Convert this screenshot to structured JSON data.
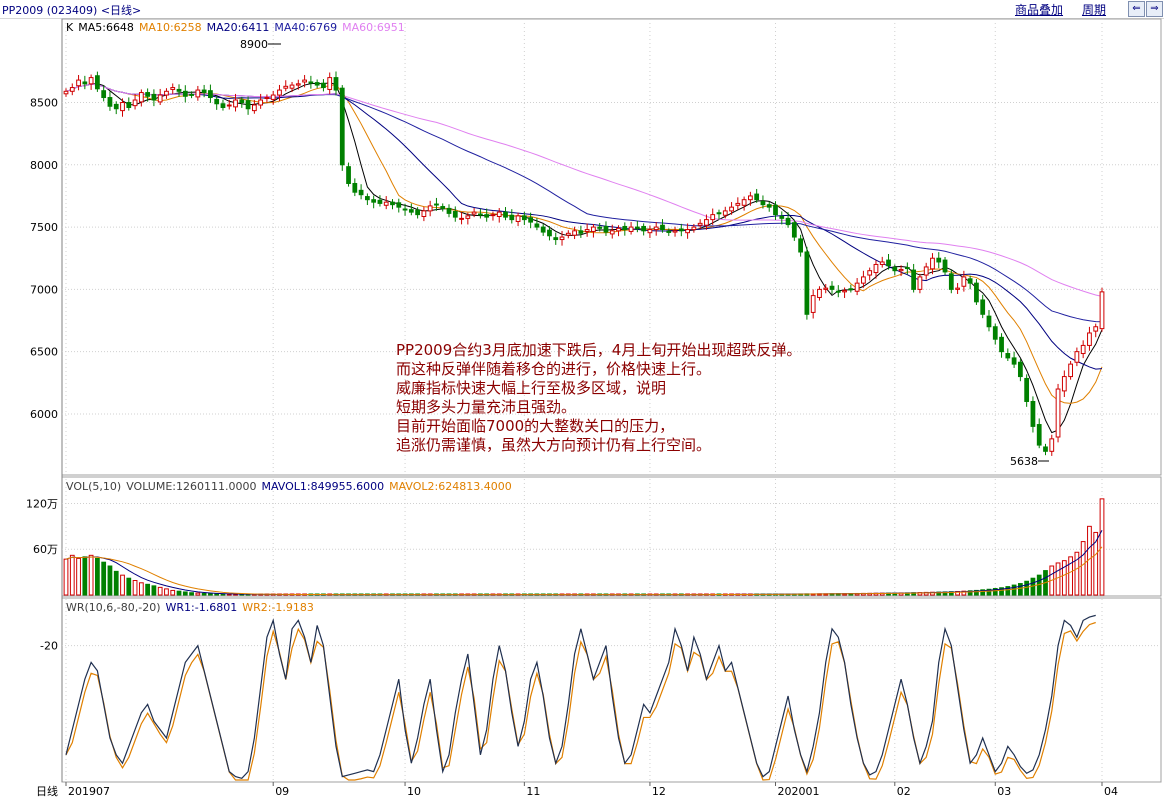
{
  "window": {
    "title": "PP2009 (023409) <日线>",
    "links": [
      "商品叠加",
      "周期"
    ],
    "nav": [
      "⇐",
      "⇒"
    ]
  },
  "colors": {
    "up": "#d00000",
    "down": "#008000",
    "ma5": "#000000",
    "ma10": "#e08000",
    "ma20": "#000080",
    "ma40": "#2020a0",
    "ma60": "#e080f0",
    "wr1": "#203050",
    "wr2": "#e08000",
    "annotation": "#8b0000",
    "grid": "#d0d0d0"
  },
  "price_panel": {
    "legend": [
      {
        "text": "K",
        "color": "#000000"
      },
      {
        "text": "MA5:6648",
        "color": "#000000"
      },
      {
        "text": "MA10:6258",
        "color": "#e08000"
      },
      {
        "text": "MA20:6411",
        "color": "#000080"
      },
      {
        "text": "MA40:6769",
        "color": "#2020a0"
      },
      {
        "text": "MA60:6951",
        "color": "#e080f0"
      }
    ],
    "y_ticks": [
      "8500",
      "8000",
      "7500",
      "7000",
      "6500",
      "6000"
    ],
    "high_label": "8900",
    "low_label": "5638",
    "annotation": [
      "PP2009合约3月底加速下跌后，4月上旬开始出现超跌反弹。",
      "而这种反弹伴随着移仓的进行，价格快速上行。",
      "威廉指标快速大幅上行至极多区域，说明",
      "短期多头力量充沛且强劲。",
      "目前开始面临7000的大整数关口的压力，",
      "追涨仍需谨慎，虽然大方向预计仍有上行空间。"
    ]
  },
  "volume_panel": {
    "legend": [
      {
        "text": "VOL(5,10)",
        "color": "#404040"
      },
      {
        "text": "VOLUME:1260111.0000",
        "color": "#404040"
      },
      {
        "text": "MAVOL1:849955.6000",
        "color": "#000080"
      },
      {
        "text": "MAVOL2:624813.4000",
        "color": "#e08000"
      }
    ],
    "y_ticks": [
      "120万",
      "60万"
    ]
  },
  "wr_panel": {
    "legend": [
      {
        "text": "WR(10,6,-80,-20)",
        "color": "#404040"
      },
      {
        "text": "WR1:-1.6801",
        "color": "#000080"
      },
      {
        "text": "WR2:-1.9183",
        "color": "#e08000"
      }
    ],
    "y_ticks": [
      "-20"
    ]
  },
  "x_axis": {
    "period_label": "日线",
    "ticks": [
      "201907",
      "09",
      "10",
      "11",
      "12",
      "202001",
      "02",
      "03",
      "04"
    ]
  },
  "chart_data": {
    "type": "candlestick",
    "title": "",
    "period": "日线",
    "x_ticks": [
      "201907",
      "09",
      "10",
      "11",
      "12",
      "202001",
      "02",
      "03",
      "04"
    ],
    "price": {
      "ylim": [
        5550,
        9050
      ],
      "y_ticks": [
        8500,
        8000,
        7500,
        7000,
        6500,
        6000
      ],
      "high": 8900,
      "low": 5638,
      "closes": [
        8590,
        8620,
        8680,
        8650,
        8700,
        8610,
        8540,
        8470,
        8450,
        8500,
        8460,
        8520,
        8580,
        8550,
        8520,
        8560,
        8590,
        8620,
        8590,
        8550,
        8560,
        8600,
        8580,
        8540,
        8490,
        8460,
        8480,
        8520,
        8500,
        8450,
        8480,
        8520,
        8540,
        8560,
        8600,
        8630,
        8640,
        8650,
        8680,
        8660,
        8640,
        8620,
        8700,
        8600,
        8000,
        7850,
        7780,
        7760,
        7720,
        7700,
        7690,
        7700,
        7680,
        7660,
        7640,
        7620,
        7600,
        7630,
        7670,
        7680,
        7650,
        7610,
        7580,
        7570,
        7590,
        7620,
        7600,
        7580,
        7600,
        7620,
        7580,
        7560,
        7590,
        7560,
        7540,
        7500,
        7460,
        7430,
        7400,
        7420,
        7450,
        7470,
        7450,
        7480,
        7500,
        7490,
        7460,
        7470,
        7490,
        7480,
        7500,
        7490,
        7470,
        7480,
        7500,
        7480,
        7460,
        7470,
        7470,
        7480,
        7500,
        7530,
        7560,
        7600,
        7610,
        7630,
        7660,
        7690,
        7720,
        7750,
        7720,
        7680,
        7660,
        7600,
        7570,
        7520,
        7420,
        7300,
        6800,
        6950,
        7000,
        7010,
        7000,
        6980,
        6990,
        7000,
        7050,
        7100,
        7150,
        7200,
        7220,
        7190,
        7150,
        7160,
        7170,
        7000,
        7100,
        7180,
        7250,
        7220,
        7140,
        7000,
        7010,
        7100,
        7050,
        6900,
        6800,
        6700,
        6600,
        6500,
        6450,
        6400,
        6300,
        6100,
        5900,
        5750,
        5700,
        5800,
        6200,
        6300,
        6400,
        6500,
        6550,
        6650,
        6700,
        6980
      ]
    },
    "volume": {
      "ylim": [
        0,
        1350000
      ],
      "y_ticks": [
        1200000,
        600000
      ],
      "last": 1260111,
      "mavol1": 849955.6,
      "mavol2": 624813.4,
      "values": [
        470000,
        520000,
        480000,
        500000,
        520000,
        480000,
        430000,
        380000,
        310000,
        260000,
        220000,
        190000,
        160000,
        140000,
        120000,
        100000,
        80000,
        60000,
        50000,
        40000,
        30000,
        25000,
        20000,
        18000,
        15000,
        12000,
        11000,
        10000,
        9000,
        8000,
        8000,
        7000,
        7000,
        6000,
        6000,
        6000,
        6000,
        6000,
        6000,
        5000,
        5000,
        5000,
        5000,
        5000,
        5000,
        5000,
        5000,
        5000,
        5000,
        5000,
        5000,
        5000,
        5000,
        5000,
        5000,
        5000,
        5000,
        5000,
        5000,
        5000,
        5000,
        5000,
        5000,
        5000,
        5000,
        5000,
        5000,
        5000,
        5000,
        5000,
        5000,
        5000,
        5000,
        5000,
        5000,
        5000,
        5000,
        5000,
        5000,
        5000,
        5000,
        5000,
        5000,
        5000,
        5000,
        5000,
        5000,
        5000,
        5000,
        5000,
        5000,
        5000,
        5000,
        5000,
        5000,
        5000,
        5000,
        6000,
        6000,
        6000,
        6000,
        6000,
        6000,
        7000,
        7000,
        7000,
        8000,
        8000,
        9000,
        9000,
        10000,
        10000,
        11000,
        11000,
        12000,
        12000,
        13000,
        14000,
        15000,
        15000,
        16000,
        16000,
        17000,
        18000,
        18000,
        19000,
        20000,
        21000,
        22000,
        23000,
        24000,
        25000,
        26000,
        27000,
        28000,
        30000,
        32000,
        34000,
        36000,
        38000,
        40000,
        43000,
        46000,
        50000,
        55000,
        60000,
        68000,
        75000,
        85000,
        95000,
        110000,
        130000,
        150000,
        180000,
        220000,
        260000,
        320000,
        380000,
        420000,
        450000,
        500000,
        560000,
        700000,
        900000,
        820000,
        1260111
      ]
    },
    "wr": {
      "ylim": [
        -100,
        0
      ],
      "y_ticks": [
        -20
      ],
      "last_wr1": -1.6801,
      "last_wr2": -1.9183,
      "wr1": [
        -85,
        -70,
        -55,
        -40,
        -30,
        -35,
        -55,
        -75,
        -85,
        -90,
        -80,
        -70,
        -60,
        -55,
        -65,
        -70,
        -75,
        -60,
        -45,
        -30,
        -25,
        -20,
        -35,
        -50,
        -65,
        -80,
        -95,
        -98,
        -99,
        -95,
        -75,
        -45,
        -15,
        -5,
        -25,
        -40,
        -10,
        -5,
        -15,
        -30,
        -8,
        -20,
        -50,
        -80,
        -98,
        -97,
        -96,
        -95,
        -94,
        -95,
        -85,
        -70,
        -55,
        -40,
        -70,
        -90,
        -75,
        -55,
        -40,
        -70,
        -95,
        -85,
        -60,
        -40,
        -25,
        -55,
        -85,
        -70,
        -40,
        -20,
        -35,
        -60,
        -80,
        -65,
        -40,
        -30,
        -50,
        -75,
        -90,
        -80,
        -55,
        -25,
        -10,
        -25,
        -40,
        -30,
        -20,
        -50,
        -75,
        -90,
        -85,
        -70,
        -55,
        -60,
        -50,
        -40,
        -30,
        -10,
        -20,
        -35,
        -15,
        -25,
        -40,
        -30,
        -20,
        -35,
        -30,
        -45,
        -60,
        -75,
        -90,
        -98,
        -95,
        -80,
        -65,
        -50,
        -70,
        -85,
        -95,
        -80,
        -60,
        -30,
        -10,
        -15,
        -30,
        -55,
        -75,
        -90,
        -97,
        -95,
        -85,
        -70,
        -55,
        -40,
        -55,
        -75,
        -90,
        -80,
        -65,
        -30,
        -10,
        -20,
        -45,
        -70,
        -90,
        -85,
        -75,
        -85,
        -95,
        -90,
        -80,
        -85,
        -92,
        -96,
        -94,
        -85,
        -70,
        -50,
        -20,
        -5,
        -8,
        -15,
        -5,
        -3,
        -2
      ]
    }
  }
}
